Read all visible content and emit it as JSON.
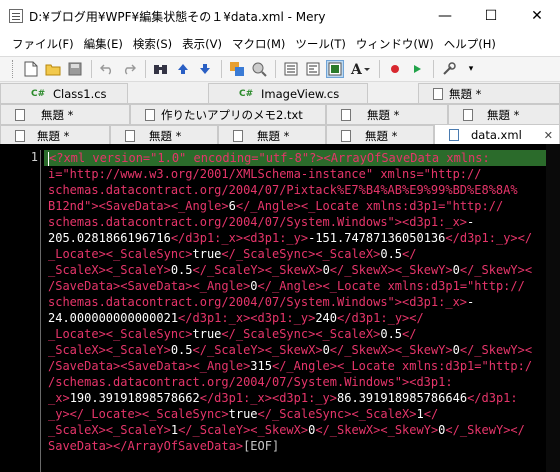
{
  "window": {
    "title": "D:¥ブログ用¥WPF¥編集状態その１¥data.xml - Mery",
    "minimize": "—",
    "maximize": "☐",
    "close": "✕"
  },
  "menu": [
    "ファイル(F)",
    "編集(E)",
    "検索(S)",
    "表示(V)",
    "マクロ(M)",
    "ツール(T)",
    "ウィンドウ(W)",
    "ヘルプ(H)"
  ],
  "toolbar": {
    "icons": [
      "new-file-icon",
      "open-folder-icon",
      "save-icon",
      "undo-icon",
      "redo-icon",
      "find-icon",
      "find-up-icon",
      "find-down-icon",
      "replace-icon",
      "grep-icon",
      "view1-icon",
      "view2-icon",
      "view3-icon",
      "font-icon",
      "record-macro-icon",
      "run-macro-icon",
      "tool-icon"
    ]
  },
  "tabs": {
    "row1": [
      {
        "label": "Class1.cs",
        "icon": "C#"
      },
      {
        "label": "ImageView.cs",
        "icon": "C#"
      },
      {
        "label": "無題 *",
        "icon": "doc"
      }
    ],
    "row2": [
      {
        "label": "無題 *"
      },
      {
        "label": "作りたいアプリのメモ2.txt"
      },
      {
        "label": "無題 *"
      },
      {
        "label": "無題 *"
      }
    ],
    "row3": [
      {
        "label": "無題 *"
      },
      {
        "label": "無題 *"
      },
      {
        "label": "無題 *"
      },
      {
        "label": "無題 *"
      },
      {
        "label": "data.xml",
        "active": true,
        "close": "✕"
      }
    ]
  },
  "editor": {
    "line_number": "1",
    "eof": "[EOF]"
  }
}
